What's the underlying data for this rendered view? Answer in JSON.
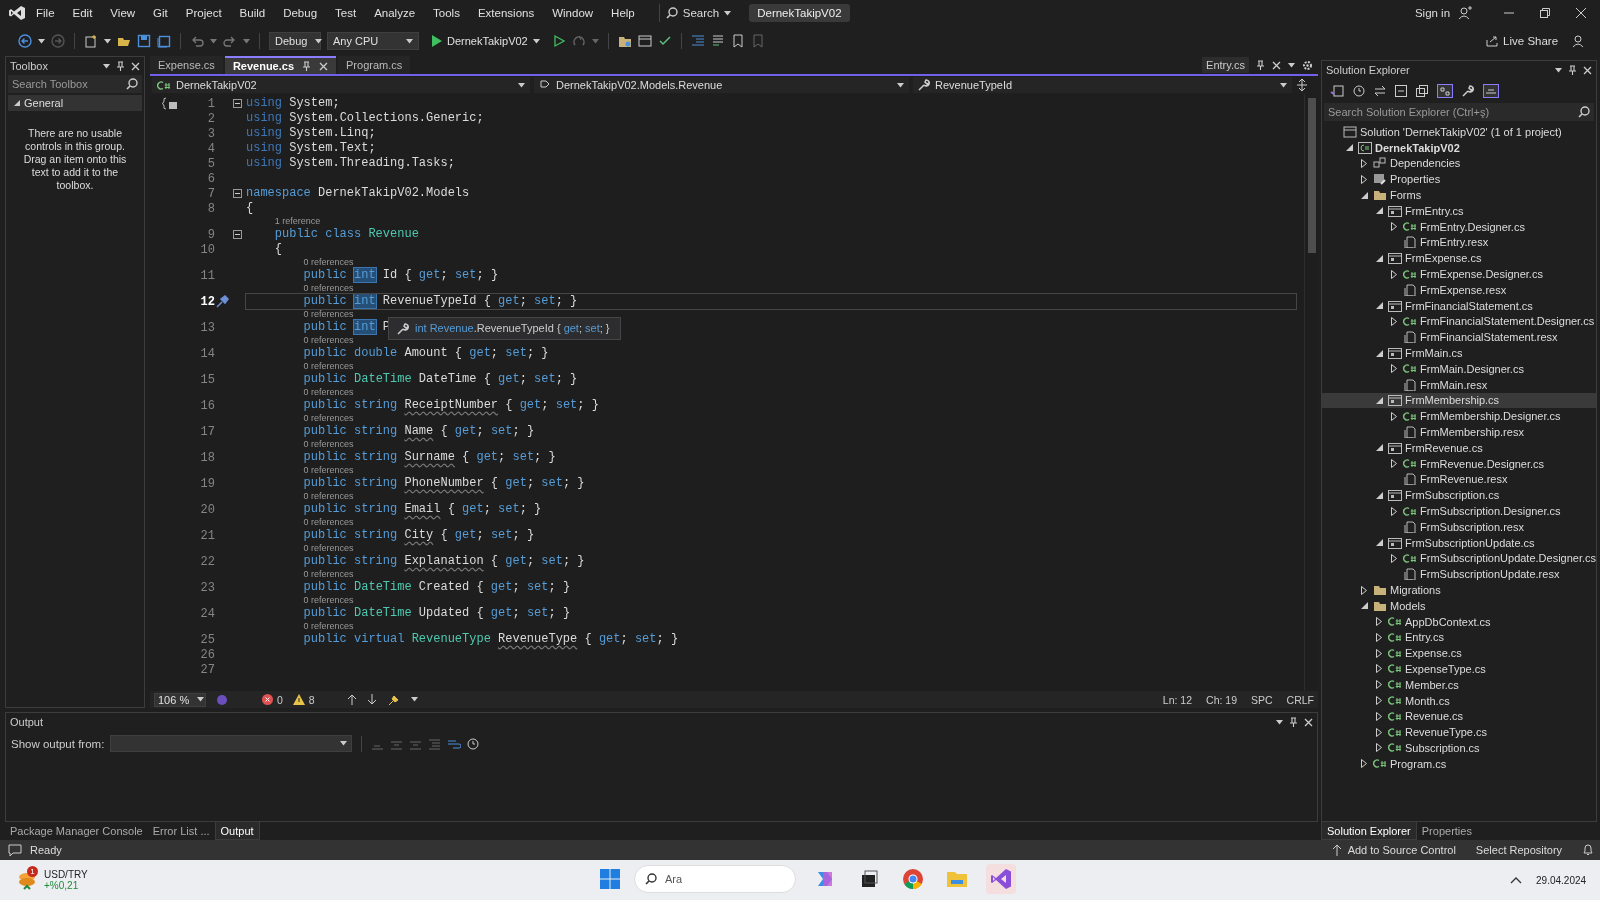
{
  "menu": {
    "items": [
      "File",
      "Edit",
      "View",
      "Git",
      "Project",
      "Build",
      "Debug",
      "Test",
      "Analyze",
      "Tools",
      "Extensions",
      "Window",
      "Help"
    ],
    "search": "Search",
    "title": "DernekTakipV02",
    "sign_in": "Sign in"
  },
  "toolbar": {
    "configuration": "Debug",
    "platform": "Any CPU",
    "run_target": "DernekTakipV02",
    "live_share": "Live Share"
  },
  "toolbox": {
    "title": "Toolbox",
    "search_placeholder": "Search Toolbox",
    "group": {
      "label": "General",
      "expanded": true
    },
    "message": "There are no usable controls in this group. Drag an item onto this text to add it to the toolbox."
  },
  "editor": {
    "tabs": [
      {
        "label": "Expense.cs",
        "selected": false,
        "pinned": false
      },
      {
        "label": "Revenue.cs",
        "selected": true,
        "pinned": true
      },
      {
        "label": "Program.cs",
        "selected": false,
        "pinned": false
      }
    ],
    "preview_tab": "Entry.cs",
    "nav": [
      "DernekTakipV02",
      "DernekTakipV02.Models.Revenue",
      "RevenueTypeId"
    ],
    "lines": [
      {
        "num": "1",
        "fold": true,
        "current": false,
        "tokens": [
          {
            "text": "using",
            "kind": "kwdim"
          },
          {
            "text": " System;",
            "kind": "plain"
          }
        ]
      },
      {
        "num": "2",
        "fold": false,
        "current": false,
        "tokens": [
          {
            "text": "using",
            "kind": "kwdim"
          },
          {
            "text": " System.Collections.Generic;",
            "kind": "plain"
          }
        ]
      },
      {
        "num": "3",
        "fold": false,
        "current": false,
        "tokens": [
          {
            "text": "using",
            "kind": "kwdim"
          },
          {
            "text": " System.Linq;",
            "kind": "plain"
          }
        ]
      },
      {
        "num": "4",
        "fold": false,
        "current": false,
        "tokens": [
          {
            "text": "using",
            "kind": "kwdim"
          },
          {
            "text": " System.Text;",
            "kind": "plain"
          }
        ]
      },
      {
        "num": "5",
        "fold": false,
        "current": false,
        "tokens": [
          {
            "text": "using",
            "kind": "kwdim"
          },
          {
            "text": " System.Threading.Tasks;",
            "kind": "plain"
          }
        ]
      },
      {
        "num": "6",
        "fold": false,
        "current": false
      },
      {
        "num": "7",
        "fold": true,
        "current": false,
        "tokens": [
          {
            "text": "namespace",
            "kind": "kw"
          },
          {
            "text": " DernekTakipV02.Models",
            "kind": "plain"
          }
        ]
      },
      {
        "num": "8",
        "fold": false,
        "current": false,
        "tokens": [
          {
            "text": "{",
            "kind": "plain"
          }
        ]
      },
      {
        "num": "9",
        "lens": "1 reference",
        "fold": true,
        "current": false,
        "tokens": [
          {
            "text": "    public class ",
            "kind": "kw"
          },
          {
            "text": "Revenue",
            "kind": "type"
          }
        ]
      },
      {
        "num": "10",
        "fold": false,
        "current": false,
        "tokens": [
          {
            "text": "    {",
            "kind": "plain"
          }
        ]
      },
      {
        "num": "11",
        "lens": "0 references",
        "fold": false,
        "current": false,
        "tokens": [
          {
            "text": "        public ",
            "kind": "kw"
          },
          {
            "text": "int",
            "kind": "hl"
          },
          {
            "text": " Id { ",
            "kind": "plain"
          },
          {
            "text": "get",
            "kind": "kw"
          },
          {
            "text": "; ",
            "kind": "plain"
          },
          {
            "text": "set",
            "kind": "kw"
          },
          {
            "text": "; }",
            "kind": "plain"
          }
        ]
      },
      {
        "num": "12",
        "lens": "0 references",
        "fold": false,
        "current": true,
        "tokens": [
          {
            "text": "        public ",
            "kind": "kw"
          },
          {
            "text": "int",
            "kind": "hl"
          },
          {
            "text": " RevenueTypeId { ",
            "kind": "plain"
          },
          {
            "text": "get",
            "kind": "kw"
          },
          {
            "text": "; ",
            "kind": "plain"
          },
          {
            "text": "set",
            "kind": "kw"
          },
          {
            "text": "; }",
            "kind": "plain"
          }
        ]
      },
      {
        "num": "13",
        "lens": "0 references",
        "fold": false,
        "current": false,
        "tokens": [
          {
            "text": "        public ",
            "kind": "kw"
          },
          {
            "text": "int",
            "kind": "hl"
          },
          {
            "text": " P",
            "kind": "plain"
          }
        ],
        "tooltip": [
          {
            "text": "int Revenue",
            "kind": "kw"
          },
          {
            "text": ".RevenueTypeId { ",
            "kind": "plain"
          },
          {
            "text": "get",
            "kind": "kw"
          },
          {
            "text": "; ",
            "kind": "plain"
          },
          {
            "text": "set",
            "kind": "kw"
          },
          {
            "text": "; }",
            "kind": "plain"
          }
        ]
      },
      {
        "num": "14",
        "lens": "0 references",
        "fold": false,
        "current": false,
        "tokens": [
          {
            "text": "        public double",
            "kind": "kw"
          },
          {
            "text": " Amount { ",
            "kind": "plain"
          },
          {
            "text": "get",
            "kind": "kw"
          },
          {
            "text": "; ",
            "kind": "plain"
          },
          {
            "text": "set",
            "kind": "kw"
          },
          {
            "text": "; }",
            "kind": "plain"
          }
        ]
      },
      {
        "num": "15",
        "lens": "0 references",
        "fold": false,
        "current": false,
        "tokens": [
          {
            "text": "        public ",
            "kind": "kw"
          },
          {
            "text": "DateTime",
            "kind": "type"
          },
          {
            "text": " DateTime { ",
            "kind": "plain"
          },
          {
            "text": "get",
            "kind": "kw"
          },
          {
            "text": "; ",
            "kind": "plain"
          },
          {
            "text": "set",
            "kind": "kw"
          },
          {
            "text": "; }",
            "kind": "plain"
          }
        ]
      },
      {
        "num": "16",
        "lens": "0 references",
        "fold": false,
        "current": false,
        "tokens": [
          {
            "text": "        public string ",
            "kind": "kw"
          },
          {
            "text": "ReceiptNumber",
            "kind": "squiggle"
          },
          {
            "text": " { ",
            "kind": "plain"
          },
          {
            "text": "get",
            "kind": "kw"
          },
          {
            "text": "; ",
            "kind": "plain"
          },
          {
            "text": "set",
            "kind": "kw"
          },
          {
            "text": "; }",
            "kind": "plain"
          }
        ]
      },
      {
        "num": "17",
        "lens": "0 references",
        "fold": false,
        "current": false,
        "tokens": [
          {
            "text": "        public string ",
            "kind": "kw"
          },
          {
            "text": "Name",
            "kind": "squiggle"
          },
          {
            "text": " { ",
            "kind": "plain"
          },
          {
            "text": "get",
            "kind": "kw"
          },
          {
            "text": "; ",
            "kind": "plain"
          },
          {
            "text": "set",
            "kind": "kw"
          },
          {
            "text": "; }",
            "kind": "plain"
          }
        ]
      },
      {
        "num": "18",
        "lens": "0 references",
        "fold": false,
        "current": false,
        "tokens": [
          {
            "text": "        public string ",
            "kind": "kw"
          },
          {
            "text": "Surname",
            "kind": "squiggle"
          },
          {
            "text": " { ",
            "kind": "plain"
          },
          {
            "text": "get",
            "kind": "kw"
          },
          {
            "text": "; ",
            "kind": "plain"
          },
          {
            "text": "set",
            "kind": "kw"
          },
          {
            "text": "; }",
            "kind": "plain"
          }
        ]
      },
      {
        "num": "19",
        "lens": "0 references",
        "fold": false,
        "current": false,
        "tokens": [
          {
            "text": "        public string ",
            "kind": "kw"
          },
          {
            "text": "PhoneNumber",
            "kind": "squiggle"
          },
          {
            "text": " { ",
            "kind": "plain"
          },
          {
            "text": "get",
            "kind": "kw"
          },
          {
            "text": "; ",
            "kind": "plain"
          },
          {
            "text": "set",
            "kind": "kw"
          },
          {
            "text": "; }",
            "kind": "plain"
          }
        ]
      },
      {
        "num": "20",
        "lens": "0 references",
        "fold": false,
        "current": false,
        "tokens": [
          {
            "text": "        public string ",
            "kind": "kw"
          },
          {
            "text": "Email",
            "kind": "squiggle"
          },
          {
            "text": " { ",
            "kind": "plain"
          },
          {
            "text": "get",
            "kind": "kw"
          },
          {
            "text": "; ",
            "kind": "plain"
          },
          {
            "text": "set",
            "kind": "kw"
          },
          {
            "text": "; }",
            "kind": "plain"
          }
        ]
      },
      {
        "num": "21",
        "lens": "0 references",
        "fold": false,
        "current": false,
        "tokens": [
          {
            "text": "        public string ",
            "kind": "kw"
          },
          {
            "text": "City",
            "kind": "squiggle"
          },
          {
            "text": " { ",
            "kind": "plain"
          },
          {
            "text": "get",
            "kind": "kw"
          },
          {
            "text": "; ",
            "kind": "plain"
          },
          {
            "text": "set",
            "kind": "kw"
          },
          {
            "text": "; }",
            "kind": "plain"
          }
        ]
      },
      {
        "num": "22",
        "lens": "0 references",
        "fold": false,
        "current": false,
        "tokens": [
          {
            "text": "        public string ",
            "kind": "kw"
          },
          {
            "text": "Explanation",
            "kind": "squiggle"
          },
          {
            "text": " { ",
            "kind": "plain"
          },
          {
            "text": "get",
            "kind": "kw"
          },
          {
            "text": "; ",
            "kind": "plain"
          },
          {
            "text": "set",
            "kind": "kw"
          },
          {
            "text": "; }",
            "kind": "plain"
          }
        ]
      },
      {
        "num": "23",
        "lens": "0 references",
        "fold": false,
        "current": false,
        "tokens": [
          {
            "text": "        public ",
            "kind": "kw"
          },
          {
            "text": "DateTime",
            "kind": "type"
          },
          {
            "text": " Created { ",
            "kind": "plain"
          },
          {
            "text": "get",
            "kind": "kw"
          },
          {
            "text": "; ",
            "kind": "plain"
          },
          {
            "text": "set",
            "kind": "kw"
          },
          {
            "text": "; }",
            "kind": "plain"
          }
        ]
      },
      {
        "num": "24",
        "lens": "0 references",
        "fold": false,
        "current": false,
        "tokens": [
          {
            "text": "        public ",
            "kind": "kw"
          },
          {
            "text": "DateTime",
            "kind": "type"
          },
          {
            "text": " Updated { ",
            "kind": "plain"
          },
          {
            "text": "get",
            "kind": "kw"
          },
          {
            "text": "; ",
            "kind": "plain"
          },
          {
            "text": "set",
            "kind": "kw"
          },
          {
            "text": "; }",
            "kind": "plain"
          }
        ]
      },
      {
        "num": "25",
        "lens": "0 references",
        "fold": false,
        "current": false,
        "tokens": [
          {
            "text": "        public virtual ",
            "kind": "kw"
          },
          {
            "text": "RevenueType ",
            "kind": "type"
          },
          {
            "text": "RevenueType",
            "kind": "squiggle"
          },
          {
            "text": " { ",
            "kind": "plain"
          },
          {
            "text": "get",
            "kind": "kw"
          },
          {
            "text": "; ",
            "kind": "plain"
          },
          {
            "text": "set",
            "kind": "kw"
          },
          {
            "text": "; }",
            "kind": "plain"
          }
        ]
      },
      {
        "num": "26",
        "fold": false,
        "current": false
      },
      {
        "num": "27",
        "fold": false,
        "current": false
      }
    ],
    "status": {
      "zoom": "106 %",
      "errors": "0",
      "warnings": "8",
      "line": "Ln: 12",
      "column": "Ch: 19",
      "whitespace": "SPC",
      "line_ending": "CRLF"
    }
  },
  "output": {
    "title": "Output",
    "show_from": "Show output from:"
  },
  "bottom_tabs": [
    {
      "label": "Package Manager Console",
      "selected": false
    },
    {
      "label": "Error List ...",
      "selected": false
    },
    {
      "label": "Output",
      "selected": true
    }
  ],
  "solution_explorer": {
    "title": "Solution Explorer",
    "search_placeholder": "Search Solution Explorer (Ctrl+ş)",
    "tree": [
      {
        "label": "Solution 'DernekTakipV02' (1 of 1 project)",
        "kind": "solution",
        "selected": false,
        "children": [
          {
            "label": "DernekTakipV02",
            "kind": "csproj",
            "expanded": true,
            "selected": false,
            "children": [
              {
                "label": "Dependencies",
                "kind": "dependencies",
                "expanded": false,
                "selected": false
              },
              {
                "label": "Properties",
                "kind": "properties",
                "expanded": false,
                "selected": false
              },
              {
                "label": "Forms",
                "kind": "folder",
                "expanded": true,
                "selected": false,
                "children": [
                  {
                    "label": "FrmEntry.cs",
                    "kind": "form",
                    "expanded": true,
                    "selected": false,
                    "children": [
                      {
                        "label": "FrmEntry.Designer.cs",
                        "kind": "csharp",
                        "expanded": false,
                        "selected": false
                      },
                      {
                        "label": "FrmEntry.resx",
                        "kind": "resx",
                        "selected": false
                      }
                    ]
                  },
                  {
                    "label": "FrmExpense.cs",
                    "kind": "form",
                    "expanded": true,
                    "selected": false,
                    "children": [
                      {
                        "label": "FrmExpense.Designer.cs",
                        "kind": "csharp",
                        "expanded": false,
                        "selected": false
                      },
                      {
                        "label": "FrmExpense.resx",
                        "kind": "resx",
                        "selected": false
                      }
                    ]
                  },
                  {
                    "label": "FrmFinancialStatement.cs",
                    "kind": "form",
                    "expanded": true,
                    "selected": false,
                    "children": [
                      {
                        "label": "FrmFinancialStatement.Designer.cs",
                        "kind": "csharp",
                        "expanded": false,
                        "selected": false
                      },
                      {
                        "label": "FrmFinancialStatement.resx",
                        "kind": "resx",
                        "selected": false
                      }
                    ]
                  },
                  {
                    "label": "FrmMain.cs",
                    "kind": "form",
                    "expanded": true,
                    "selected": false,
                    "children": [
                      {
                        "label": "FrmMain.Designer.cs",
                        "kind": "csharp",
                        "expanded": false,
                        "selected": false
                      },
                      {
                        "label": "FrmMain.resx",
                        "kind": "resx",
                        "selected": false
                      }
                    ]
                  },
                  {
                    "label": "FrmMembership.cs",
                    "kind": "form",
                    "expanded": true,
                    "selected": true,
                    "children": [
                      {
                        "label": "FrmMembership.Designer.cs",
                        "kind": "csharp",
                        "expanded": false,
                        "selected": false
                      },
                      {
                        "label": "FrmMembership.resx",
                        "kind": "resx",
                        "selected": false
                      }
                    ]
                  },
                  {
                    "label": "FrmRevenue.cs",
                    "kind": "form",
                    "expanded": true,
                    "selected": false,
                    "children": [
                      {
                        "label": "FrmRevenue.Designer.cs",
                        "kind": "csharp",
                        "expanded": false,
                        "selected": false
                      },
                      {
                        "label": "FrmRevenue.resx",
                        "kind": "resx",
                        "selected": false
                      }
                    ]
                  },
                  {
                    "label": "FrmSubscription.cs",
                    "kind": "form",
                    "expanded": true,
                    "selected": false,
                    "children": [
                      {
                        "label": "FrmSubscription.Designer.cs",
                        "kind": "csharp",
                        "expanded": false,
                        "selected": false
                      },
                      {
                        "label": "FrmSubscription.resx",
                        "kind": "resx",
                        "selected": false
                      }
                    ]
                  },
                  {
                    "label": "FrmSubscriptionUpdate.cs",
                    "kind": "form",
                    "expanded": true,
                    "selected": false,
                    "children": [
                      {
                        "label": "FrmSubscriptionUpdate.Designer.cs",
                        "kind": "csharp",
                        "expanded": false,
                        "selected": false
                      },
                      {
                        "label": "FrmSubscriptionUpdate.resx",
                        "kind": "resx",
                        "selected": false
                      }
                    ]
                  }
                ]
              },
              {
                "label": "Migrations",
                "kind": "folder",
                "expanded": false,
                "selected": false
              },
              {
                "label": "Models",
                "kind": "folder",
                "expanded": true,
                "selected": false,
                "children": [
                  {
                    "label": "AppDbContext.cs",
                    "kind": "csharp",
                    "expanded": false,
                    "selected": false
                  },
                  {
                    "label": "Entry.cs",
                    "kind": "csharp",
                    "expanded": false,
                    "selected": false
                  },
                  {
                    "label": "Expense.cs",
                    "kind": "csharp",
                    "expanded": false,
                    "selected": false
                  },
                  {
                    "label": "ExpenseType.cs",
                    "kind": "csharp",
                    "expanded": false,
                    "selected": false
                  },
                  {
                    "label": "Member.cs",
                    "kind": "csharp",
                    "expanded": false,
                    "selected": false
                  },
                  {
                    "label": "Month.cs",
                    "kind": "csharp",
                    "expanded": false,
                    "selected": false
                  },
                  {
                    "label": "Revenue.cs",
                    "kind": "csharp",
                    "expanded": false,
                    "selected": false
                  },
                  {
                    "label": "RevenueType.cs",
                    "kind": "csharp",
                    "expanded": false,
                    "selected": false
                  },
                  {
                    "label": "Subscription.cs",
                    "kind": "csharp",
                    "expanded": false,
                    "selected": false
                  }
                ]
              },
              {
                "label": "Program.cs",
                "kind": "csharp",
                "expanded": false,
                "selected": false
              }
            ]
          }
        ]
      }
    ],
    "tabs": [
      {
        "label": "Solution Explorer",
        "selected": true
      },
      {
        "label": "Properties",
        "selected": false
      }
    ]
  },
  "status_bar": {
    "text": "Ready",
    "source_control": "Add to Source Control",
    "repository": "Select Repository"
  },
  "taskbar": {
    "widget": {
      "title": "USD/TRY",
      "change": "+%0,21",
      "badge": "1"
    },
    "search_placeholder": "Ara",
    "date": "29.04.2024"
  }
}
